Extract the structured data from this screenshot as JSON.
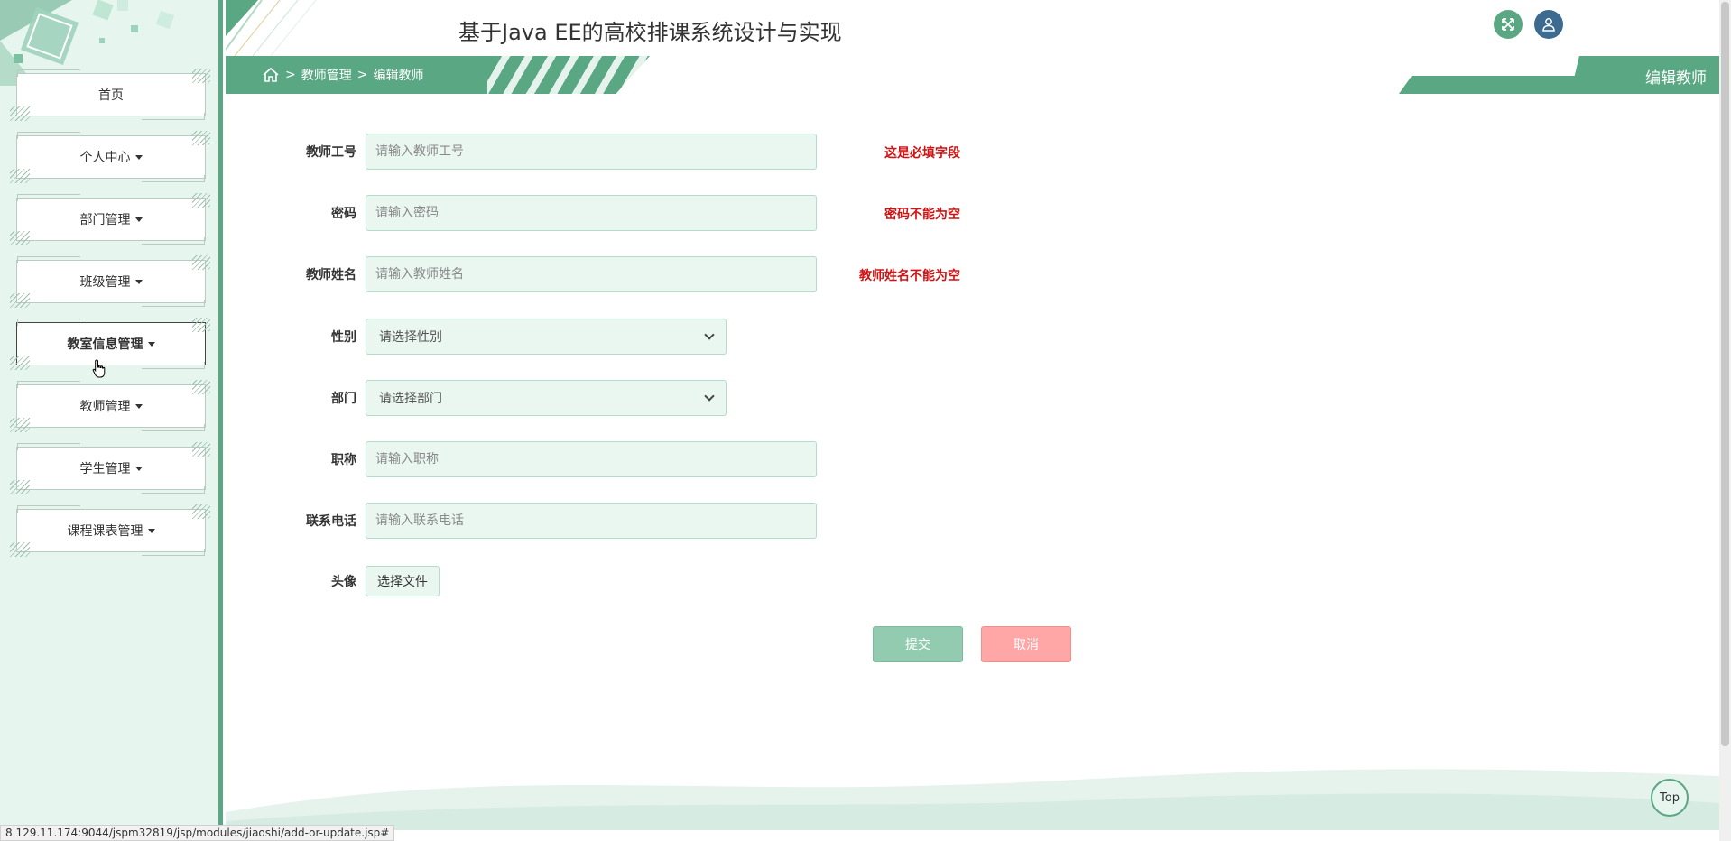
{
  "app": {
    "title": "基于Java EE的高校排课系统设计与实现"
  },
  "sidebar": {
    "items": [
      {
        "label": "首页",
        "has_caret": false
      },
      {
        "label": "个人中心",
        "has_caret": true
      },
      {
        "label": "部门管理",
        "has_caret": true
      },
      {
        "label": "班级管理",
        "has_caret": true
      },
      {
        "label": "教室信息管理",
        "has_caret": true,
        "hovered": true
      },
      {
        "label": "教师管理",
        "has_caret": true
      },
      {
        "label": "学生管理",
        "has_caret": true
      },
      {
        "label": "课程课表管理",
        "has_caret": true
      }
    ]
  },
  "header": {
    "fullscreen_icon": "expand-icon",
    "user_icon": "user-icon"
  },
  "breadcrumb": {
    "home_icon": "home-icon",
    "separator": ">",
    "parent": "教师管理",
    "current": "编辑教师"
  },
  "page": {
    "tag": "编辑教师"
  },
  "form": {
    "teacher_id": {
      "label": "教师工号",
      "placeholder": "请输入教师工号",
      "error": "这是必填字段"
    },
    "password": {
      "label": "密码",
      "placeholder": "请输入密码",
      "error": "密码不能为空"
    },
    "teacher_name": {
      "label": "教师姓名",
      "placeholder": "请输入教师姓名",
      "error": "教师姓名不能为空"
    },
    "gender": {
      "label": "性别",
      "selected": "请选择性别"
    },
    "department": {
      "label": "部门",
      "selected": "请选择部门"
    },
    "title": {
      "label": "职称",
      "placeholder": "请输入职称"
    },
    "phone": {
      "label": "联系电话",
      "placeholder": "请输入联系电话"
    },
    "avatar": {
      "label": "头像",
      "button": "选择文件"
    },
    "submit": "提交",
    "cancel": "取消"
  },
  "footer": {
    "top_button": "Top",
    "status_url": "8.129.11.174:9044/jspm32819/jsp/modules/jiaoshi/add-or-update.jsp#"
  },
  "colors": {
    "accent": "#5aa883",
    "sidebar_bg": "#e6f6ef",
    "error": "#d01212",
    "submit": "#93cbb0",
    "cancel": "#ffa7a7"
  }
}
